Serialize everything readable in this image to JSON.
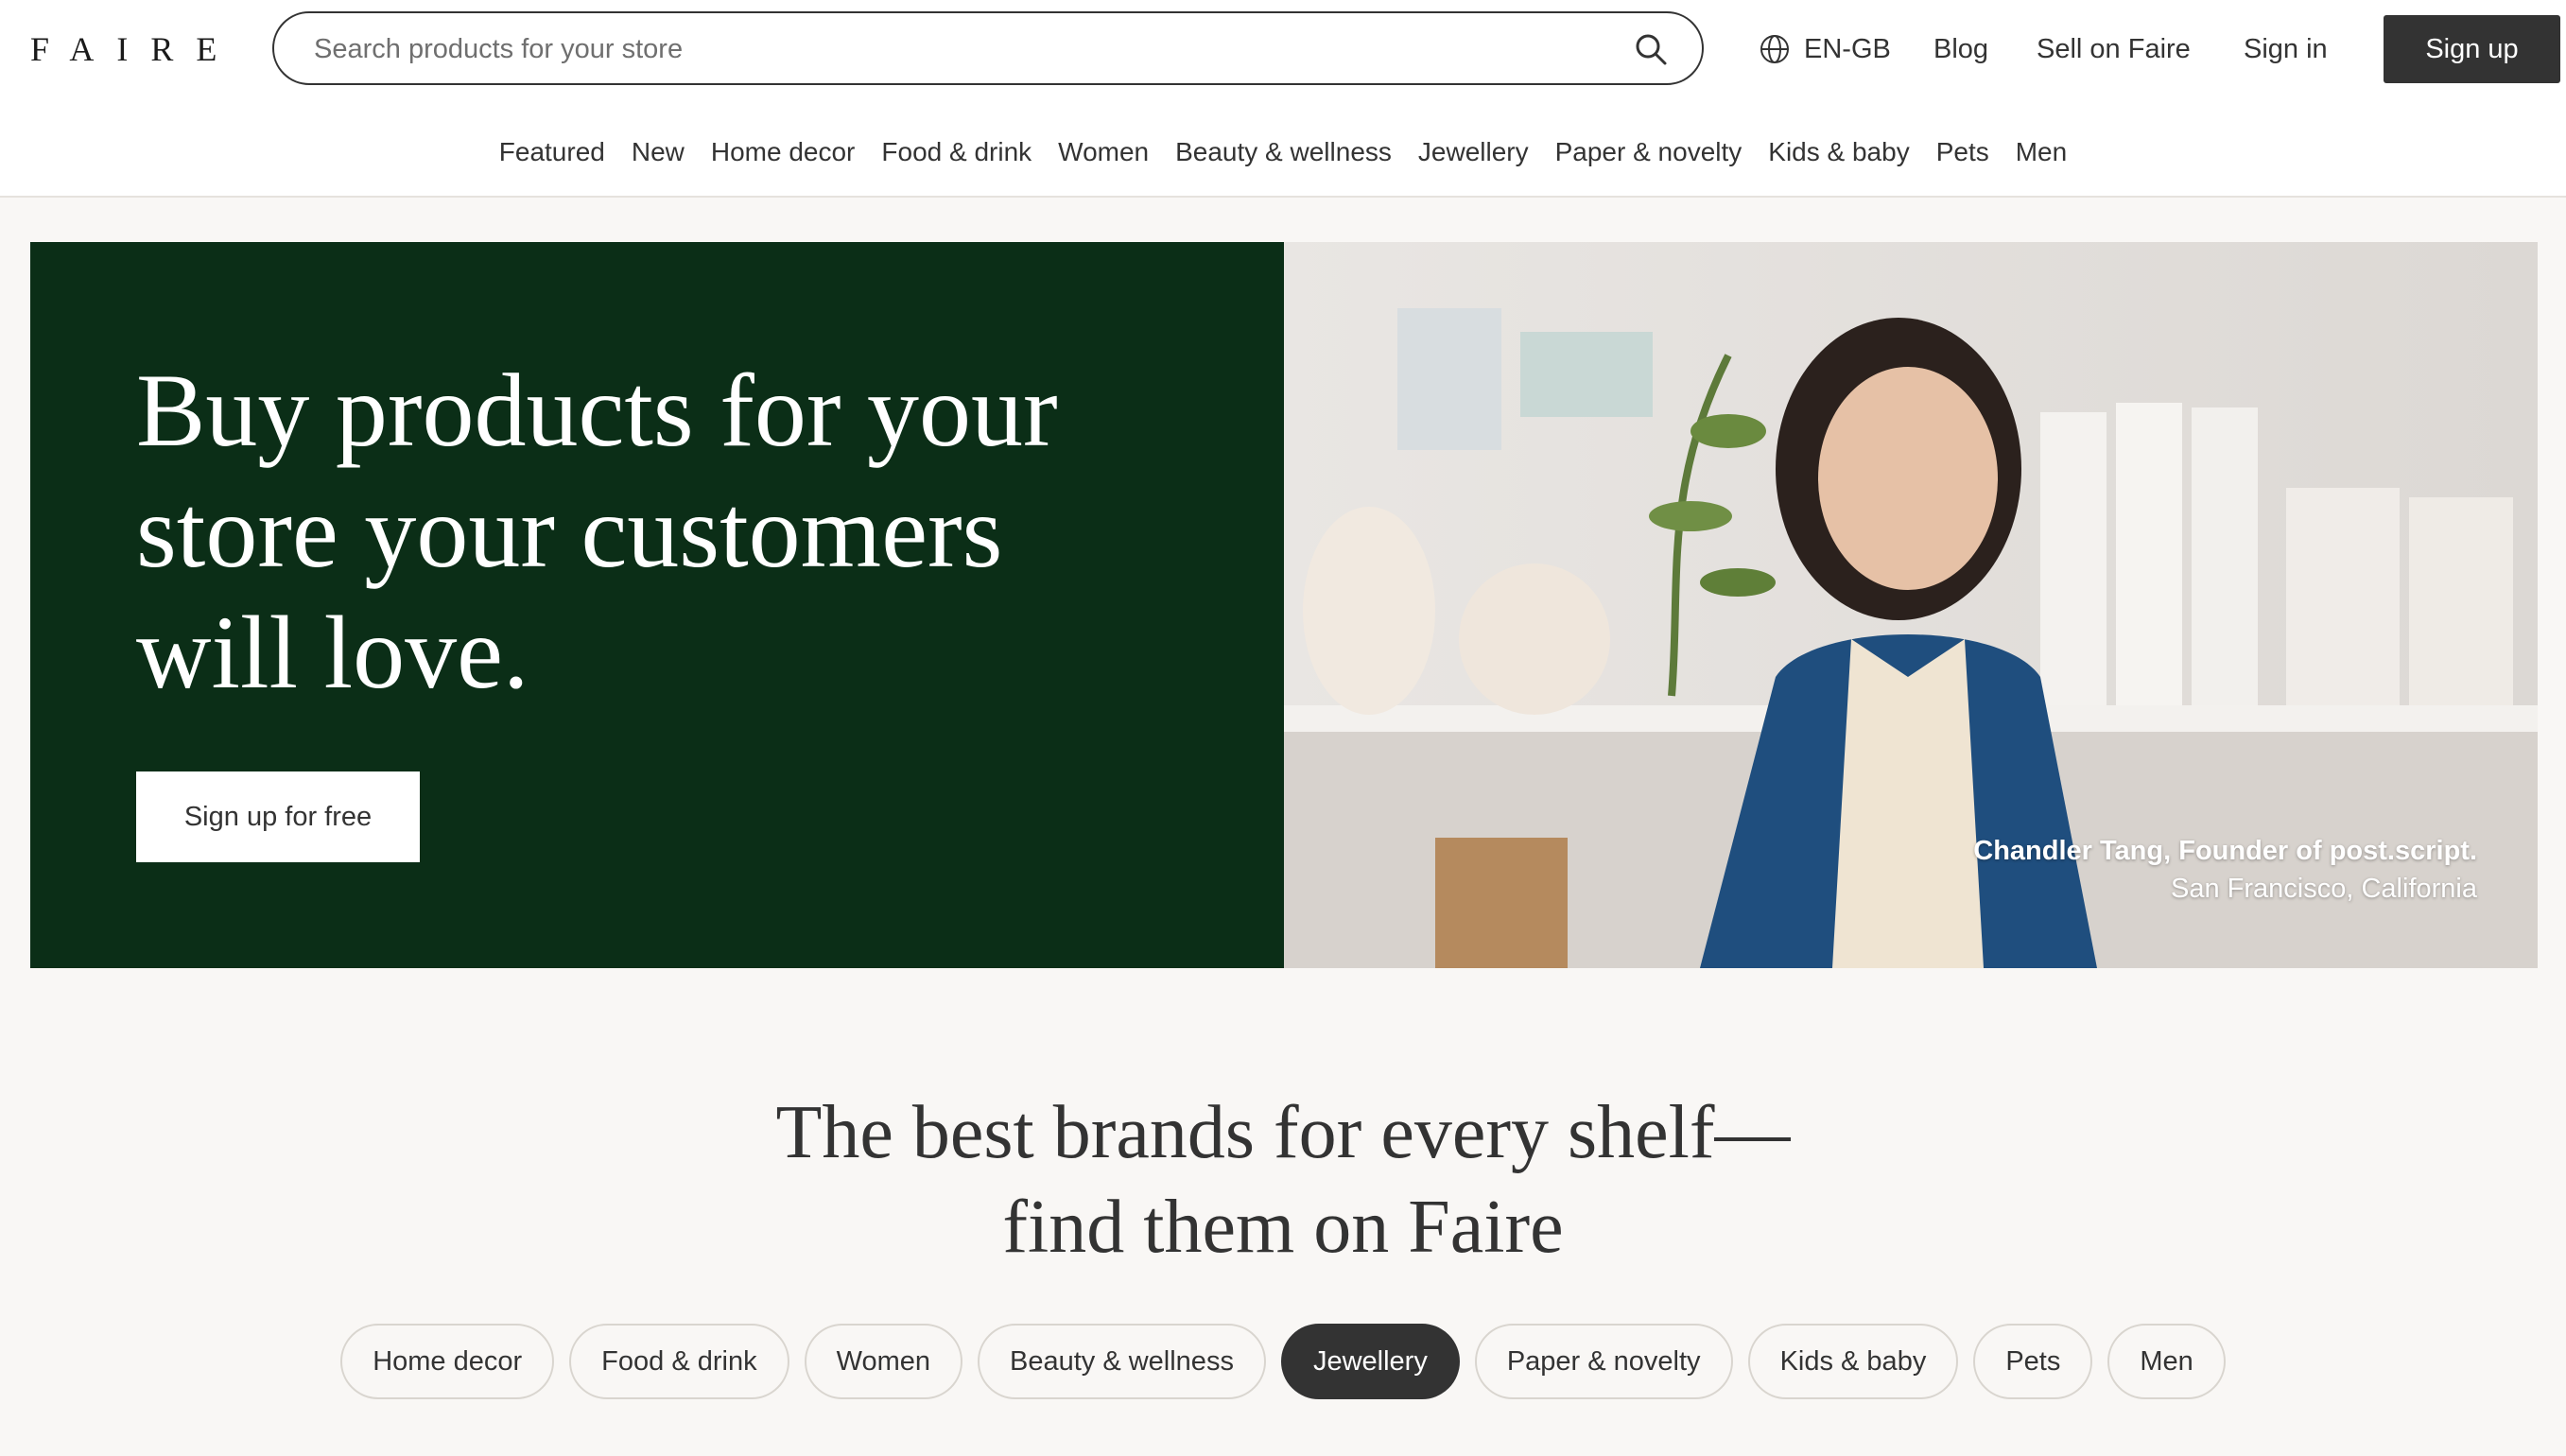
{
  "header": {
    "logo": "FAIRE",
    "search": {
      "placeholder": "Search products for your store",
      "value": ""
    },
    "locale": "EN-GB",
    "links": {
      "blog": "Blog",
      "sell": "Sell on Faire",
      "sign_in": "Sign in"
    },
    "sign_up": "Sign up"
  },
  "nav": {
    "items": [
      "Featured",
      "New",
      "Home decor",
      "Food & drink",
      "Women",
      "Beauty & wellness",
      "Jewellery",
      "Paper & novelty",
      "Kids & baby",
      "Pets",
      "Men"
    ]
  },
  "hero": {
    "title": "Buy products for your store your customers will love.",
    "cta": "Sign up for free",
    "caption_name": "Chandler Tang, Founder of post.script.",
    "caption_location": "San Francisco, California"
  },
  "brands": {
    "title_line1": "The best brands for every shelf—",
    "title_line2": "find them on Faire",
    "pills": [
      "Home decor",
      "Food & drink",
      "Women",
      "Beauty & wellness",
      "Jewellery",
      "Paper & novelty",
      "Kids & baby",
      "Pets",
      "Men"
    ],
    "active_pill": "Jewellery"
  },
  "colors": {
    "hero_green": "#0b2e17",
    "dark": "#333333",
    "background": "#f9f7f5"
  }
}
